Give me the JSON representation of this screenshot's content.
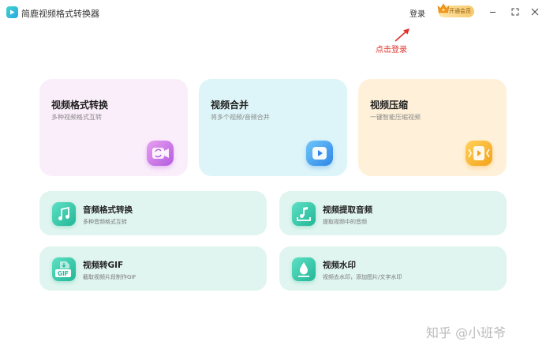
{
  "app": {
    "title": "简鹿视频格式转换器"
  },
  "header": {
    "login_label": "登录",
    "vip_label": "开通会员"
  },
  "annotation": {
    "text": "点击登录",
    "color": "#e0322b"
  },
  "big_cards": [
    {
      "title": "视频格式转换",
      "subtitle": "多种视频格式互转",
      "icon": "video-convert-icon"
    },
    {
      "title": "视频合并",
      "subtitle": "将多个视频/音频合并",
      "icon": "video-merge-icon"
    },
    {
      "title": "视频压缩",
      "subtitle": "一键智能压缩视频",
      "icon": "video-compress-icon"
    }
  ],
  "small_cards": [
    {
      "title": "音频格式转换",
      "subtitle": "多种音频格式互转",
      "icon": "music-note-icon"
    },
    {
      "title": "视频提取音频",
      "subtitle": "提取视频中的音频",
      "icon": "extract-audio-icon"
    },
    {
      "title": "视频转GIF",
      "subtitle": "截取视频片段制作GIF",
      "icon": "gif-icon",
      "icon_text": "GIF"
    },
    {
      "title": "视频水印",
      "subtitle": "视频去水印，添加图片/文字水印",
      "icon": "watermark-drop-icon"
    }
  ],
  "watermark": {
    "text": "知乎 @小班爷"
  },
  "colors": {
    "card_convert": "#fbeefb",
    "card_merge": "#ddf5f8",
    "card_compress": "#fff1d9",
    "card_small": "#e0f5ef",
    "accent_teal": "#23b697"
  }
}
